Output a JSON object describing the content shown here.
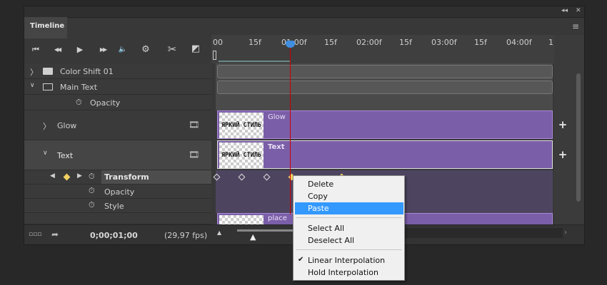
{
  "panel": {
    "title": "Timeline",
    "collapse_glyph": "◂◂",
    "close_glyph": "✕",
    "menu_glyph": "≡"
  },
  "toolbar": {
    "first_frame": "⏮",
    "prev_frame": "◀◀",
    "play": "▶",
    "next_frame": "▶▶",
    "audio": "🔈",
    "settings": "⚙",
    "split": "✂",
    "transition": "◩"
  },
  "ruler": {
    "ticks": [
      "00",
      "15f",
      "01:00f",
      "15f",
      "02:00f",
      "15f",
      "03:00f",
      "15f",
      "04:00f",
      "1"
    ]
  },
  "layers": [
    {
      "name": "Color Shift 01",
      "expanded": false,
      "icon": "folder-icon"
    },
    {
      "name": "Main Text",
      "expanded": true,
      "icon": "folder-icon"
    },
    {
      "name": "Opacity",
      "icon": "stopwatch-icon"
    },
    {
      "name": "Glow",
      "expanded": false
    },
    {
      "name": "Text",
      "expanded": true
    },
    {
      "name": "Transform",
      "icon": "stopwatch-icon",
      "selected": true
    },
    {
      "name": "Opacity",
      "icon": "stopwatch-icon"
    },
    {
      "name": "Style",
      "icon": "stopwatch-icon"
    }
  ],
  "clips": {
    "glow": {
      "label": "Glow",
      "thumb_text": "ЯРКИЙ СТИЛЬ"
    },
    "text": {
      "label": "Text",
      "thumb_text": "ЯРКИЙ СТИЛЬ"
    },
    "place": {
      "label": "place"
    }
  },
  "footer": {
    "timecode": "0;00;01;00",
    "fps": "(29,97 fps)"
  },
  "context_menu": {
    "items": [
      "Delete",
      "Copy",
      "Paste",
      "Select All",
      "Deselect All",
      "Linear Interpolation",
      "Hold Interpolation"
    ],
    "highlighted": "Paste",
    "checked": "Linear Interpolation"
  },
  "colors": {
    "clip_purple": "#7b5ea8",
    "playhead": "#cc0000",
    "menu_highlight": "#3399ff",
    "keyframe_selected": "#f0d060"
  }
}
